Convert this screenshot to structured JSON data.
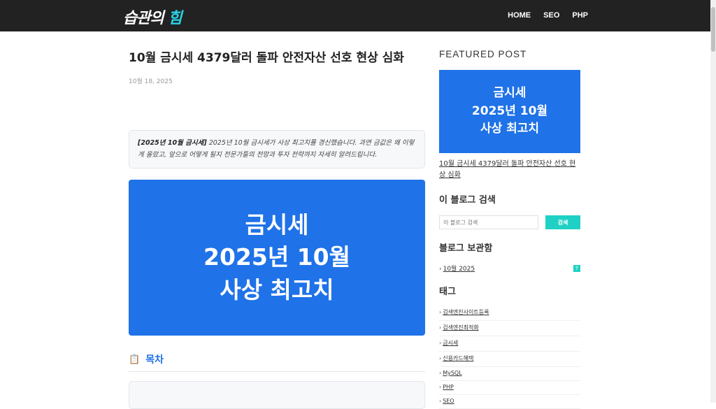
{
  "header": {
    "logo_main": "습관의 ",
    "logo_accent": "힘",
    "nav": [
      "HOME",
      "SEO",
      "PHP"
    ]
  },
  "post": {
    "title": "10월 금시세 4379달러 돌파 안전자산 선호 현상 심화",
    "date": "10월 18, 2025",
    "summary_bold": "[2025년 10월 금시세]",
    "summary_text": " 2025년 10월 금시세가 사상 최고치를 경신했습니다. 과연 금값은 왜 이렇게 올랐고, 앞으로 어떻게 될지 전문가들의 전망과 투자 전략까지 자세히 알려드립니다.",
    "hero_lines": [
      "금시세",
      "2025년 10월",
      "사상 최고치"
    ],
    "toc_icon": "📋",
    "toc_title": "목차"
  },
  "sidebar": {
    "featured_heading": "FEATURED POST",
    "featured_img_lines": [
      "금시세",
      "2025년 10월",
      "사상 최고치"
    ],
    "featured_link": "10월 금시세 4379달러 돌파 안전자산 선호 현상 심화",
    "search_heading": "이 블로그 검색",
    "search_placeholder": "이 블로그 검색",
    "search_button": "검색",
    "archive_heading": "블로그 보관함",
    "archive_item": "10월 2025",
    "archive_count": "7",
    "tags_heading": "태그",
    "tags": [
      "검색엔진사이트등록",
      "검색엔진최적화",
      "금시세",
      "신용카드혜택",
      "MySQL",
      "PHP",
      "SEO"
    ]
  },
  "colors": {
    "header_bg": "#222222",
    "accent_blue": "#1f72e8",
    "accent_teal": "#1fd1c4"
  }
}
